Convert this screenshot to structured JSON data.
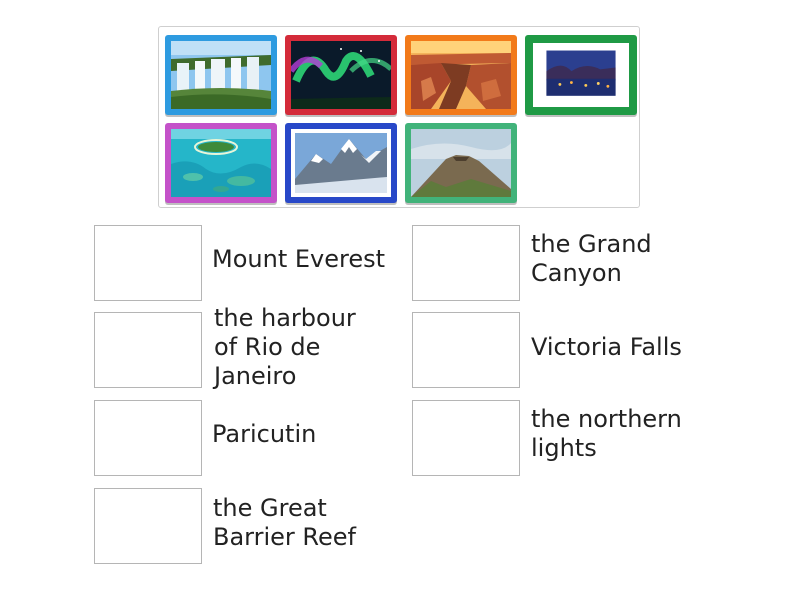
{
  "tiles": [
    {
      "icon": "waterfall-photo",
      "frame_color": "#2e9be0"
    },
    {
      "icon": "aurora-photo",
      "frame_color": "#d42b3a"
    },
    {
      "icon": "canyon-photo",
      "frame_color": "#f27a1a"
    },
    {
      "icon": "city-harbour-photo",
      "frame_color": "#1f9a45"
    },
    {
      "icon": "reef-island-photo",
      "frame_color": "#c452c9"
    },
    {
      "icon": "snowy-mountain-photo",
      "frame_color": "#2848c8"
    },
    {
      "icon": "volcano-photo",
      "frame_color": "#41b37a"
    }
  ],
  "answers": [
    {
      "label": "Mount Everest"
    },
    {
      "label": "the Grand\nCanyon"
    },
    {
      "label": "the harbour\nof Rio de\nJaneiro"
    },
    {
      "label": "Victoria Falls"
    },
    {
      "label": "Paricutin"
    },
    {
      "label": "the northern\nlights"
    },
    {
      "label": "the Great\nBarrier Reef"
    }
  ]
}
